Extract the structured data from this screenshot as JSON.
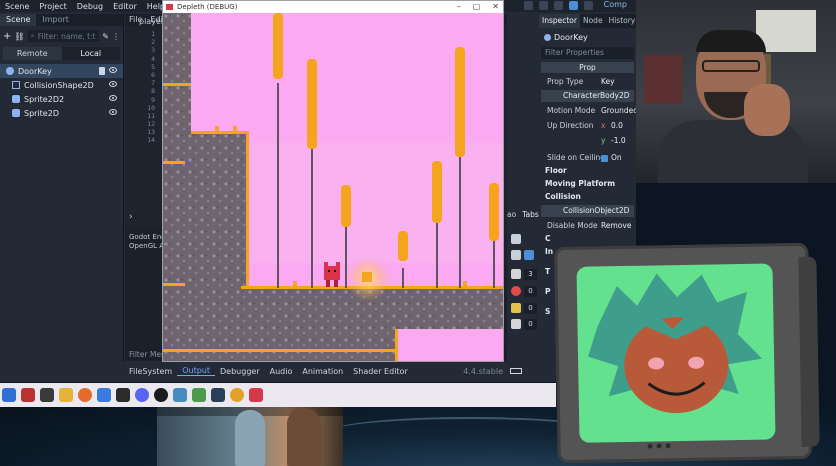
{
  "menu": [
    "Scene",
    "Project",
    "Debug",
    "Editor",
    "Help"
  ],
  "menu_right": "Comp",
  "scene_dock": {
    "tabs": [
      "Scene",
      "Import"
    ],
    "filter_placeholder": "Filter: name, t:t",
    "remote_label": "Remote",
    "local_label": "Local",
    "tree": [
      {
        "label": "DoorKey",
        "icon": "characterbody2d-icon"
      },
      {
        "label": "CollisionShape2D",
        "icon": "collisionshape2d-icon"
      },
      {
        "label": "Sprite2D2",
        "icon": "sprite2d-icon"
      },
      {
        "label": "Sprite2D",
        "icon": "sprite2d-icon"
      }
    ]
  },
  "script_editor": {
    "tabs": [
      "File",
      "Edit"
    ],
    "file_tab": "player",
    "line_numbers": [
      "1",
      "2",
      "3",
      "4",
      "5",
      "6",
      "7",
      "8",
      "9",
      "10",
      "11",
      "12",
      "13",
      "14"
    ],
    "output_lines": [
      "Godot Eng",
      "OpenGL AP"
    ],
    "filter_messages": "Filter Messages"
  },
  "bottom_tabs": [
    "FileSystem",
    "Output",
    "Debugger",
    "Audio",
    "Animation",
    "Shader Editor"
  ],
  "bottom_active": "Output",
  "version": "4.4.stable",
  "mid_dock": {
    "tabs_text": "Tabs",
    "num_prefix": "ao",
    "counts": [
      "3",
      "0",
      "0",
      "0"
    ]
  },
  "inspector": {
    "tabs": [
      "Inspector",
      "Node",
      "History"
    ],
    "node_name": "DoorKey",
    "filter_placeholder": "Filter Properties",
    "header": "Prop",
    "rows": [
      {
        "label": "Prop Type",
        "value": "Key"
      }
    ],
    "subheader": "CharacterBody2D",
    "motion_mode": {
      "label": "Motion Mode",
      "value": "Grounded"
    },
    "up_direction": {
      "label": "Up Direction",
      "x": "0.0",
      "y": "-1.0"
    },
    "slide_on_ceiling": {
      "label": "Slide on Ceiling",
      "value": "On"
    },
    "sections": [
      "Floor",
      "Moving Platform",
      "Collision"
    ],
    "collision_object": "CollisionObject2D",
    "disable_mode": {
      "label": "Disable Mode",
      "value": "Remove"
    },
    "extra": [
      "C",
      "In",
      "T",
      "P",
      "S"
    ]
  },
  "game_window": {
    "title": "Depleth (DEBUG)"
  },
  "colors": {
    "game_sky": "#fbaaf1",
    "ground_orange": "#f4a41d",
    "rock": "#8a7a86",
    "vtuber_bg": "#64e18e",
    "accent_blue": "#4a8fd8"
  }
}
